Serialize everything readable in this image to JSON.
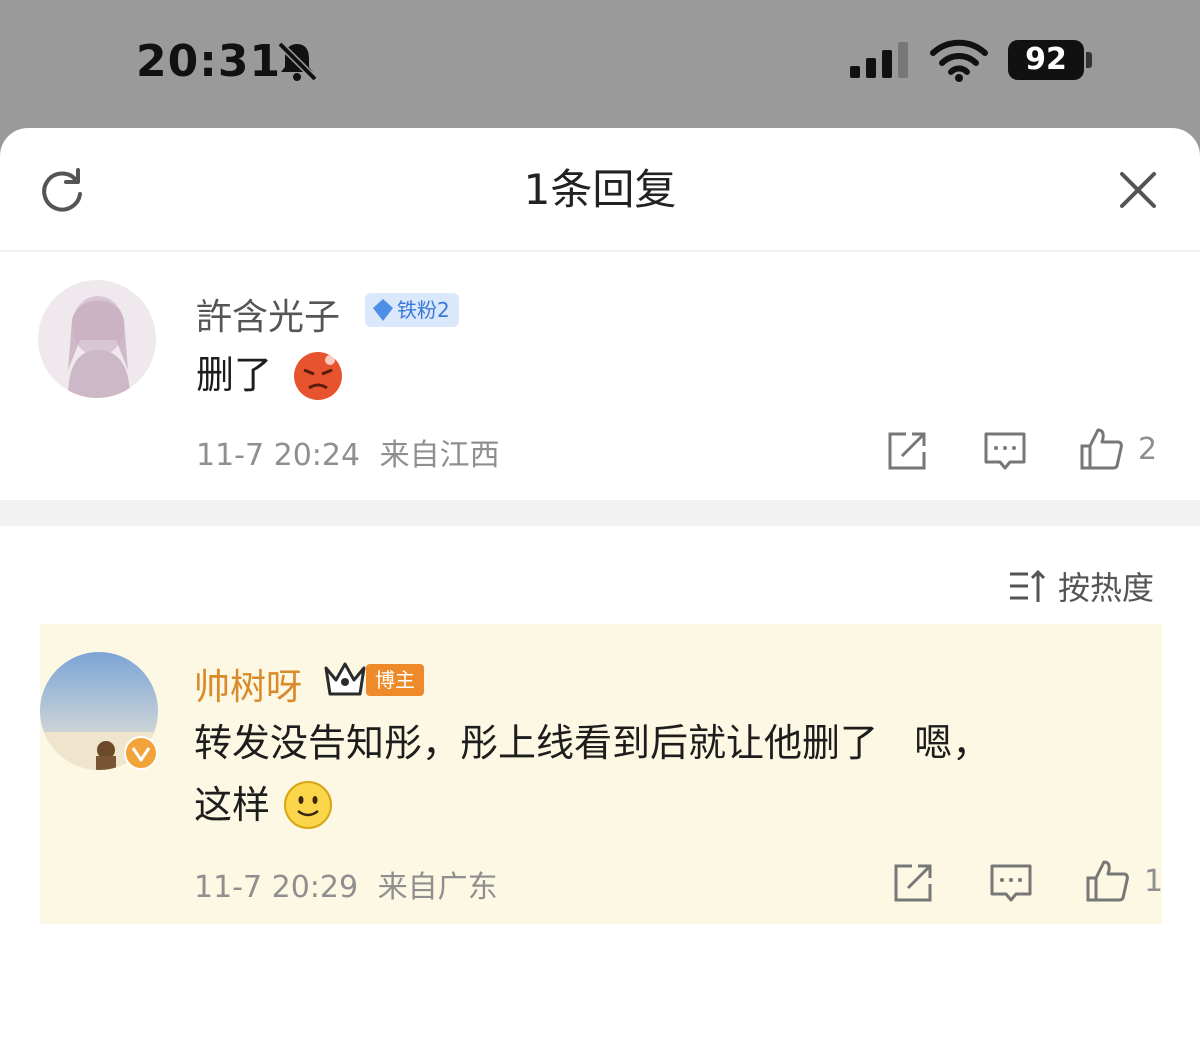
{
  "status_bar": {
    "time": "20:31",
    "battery": "92",
    "icons": [
      "bell-muted-icon",
      "signal-icon",
      "wifi-icon",
      "battery-icon"
    ]
  },
  "header": {
    "title": "1条回复",
    "refresh_icon": "refresh-icon",
    "close_icon": "close-icon"
  },
  "main_comment": {
    "username": "許含光子",
    "badge": "铁粉2",
    "text": "删了",
    "emoji": "angry-face-emoji",
    "time": "11-7 20:24",
    "location": "来自江西",
    "like_count": "2",
    "actions": [
      "share-icon",
      "comment-icon",
      "like-icon"
    ]
  },
  "sort": {
    "label": "按热度",
    "icon": "sort-icon"
  },
  "reply": {
    "username": "帅树呀",
    "badge": "博主",
    "text_line1": "转发没告知彤，彤上线看到后就让他删了   嗯，",
    "text_line2": "这样",
    "emoji": "smile-face-emoji",
    "time": "11-7 20:29",
    "location": "来自广东",
    "like_count": "1",
    "actions": [
      "share-icon",
      "comment-icon",
      "like-icon"
    ]
  },
  "colors": {
    "username_main": "#555555",
    "username_reply": "#d98a2b",
    "highlight_bg": "#fdf8e3",
    "meta": "#8f8f8f",
    "badge_host": "#ee8a2a",
    "badge_fan": "#3a78d8"
  }
}
